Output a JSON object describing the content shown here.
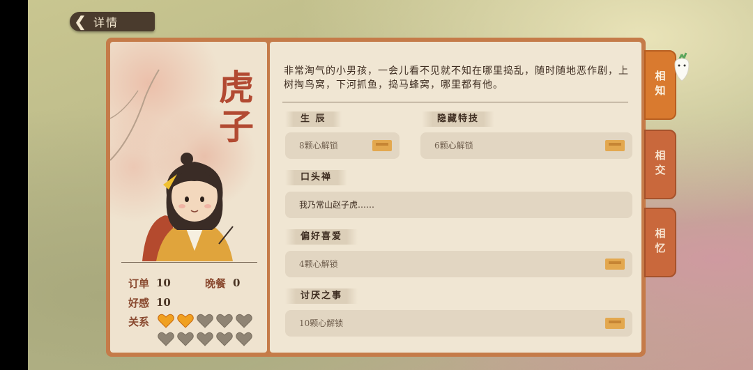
{
  "header": {
    "back_label": "详情"
  },
  "character": {
    "name": "虎子",
    "name_line1": "虎",
    "name_line2": "子"
  },
  "stats": {
    "orders_label": "订单",
    "orders_value": "10",
    "dinner_label": "晚餐",
    "dinner_value": "0",
    "favor_label": "好感",
    "favor_value": "10",
    "relation_label": "关系",
    "relation_hearts_filled": 2,
    "relation_hearts_total": 10
  },
  "profile": {
    "description": "非常淘气的小男孩，一会儿看不见就不知在哪里捣乱，随时随地恶作剧，上树掏鸟窝，下河抓鱼，捣马蜂窝，哪里都有他。",
    "birthday": {
      "label": "生  辰",
      "value": "8颗心解锁"
    },
    "hidden_skill": {
      "label": "隐藏特技",
      "value": "6颗心解锁"
    },
    "catchphrase": {
      "label": "口头禅",
      "value": "我乃常山赵子虎……"
    },
    "likes": {
      "label": "偏好喜爱",
      "value": "4颗心解锁"
    },
    "dislikes": {
      "label": "讨厌之事",
      "value": "10颗心解锁"
    }
  },
  "tabs": [
    {
      "label": "相知",
      "active": true
    },
    {
      "label": "相交",
      "active": false
    },
    {
      "label": "相忆",
      "active": false
    }
  ],
  "colors": {
    "accent": "#d97a2f",
    "name_red": "#b24a32",
    "heart_filled": "#f0a020",
    "heart_empty": "#8f8474"
  }
}
